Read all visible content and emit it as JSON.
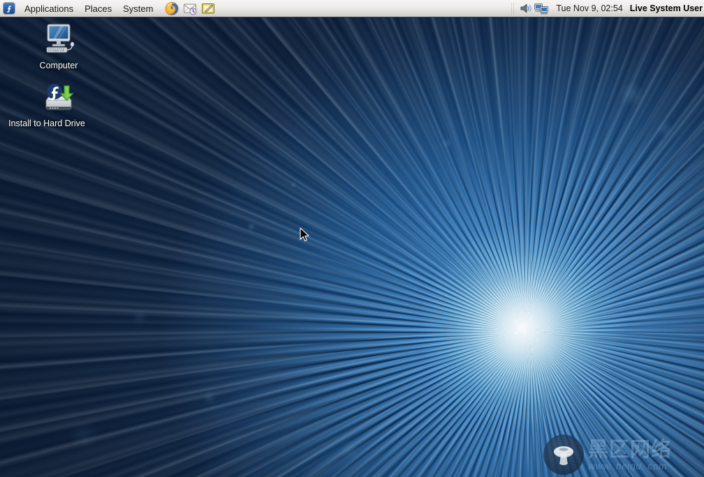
{
  "panel": {
    "distro_logo_name": "fedora-logo-icon",
    "menus": [
      {
        "label": "Applications",
        "name": "menu-applications"
      },
      {
        "label": "Places",
        "name": "menu-places"
      },
      {
        "label": "System",
        "name": "menu-system"
      }
    ],
    "launchers": [
      {
        "name": "firefox-launcher-icon",
        "title": "Firefox Web Browser"
      },
      {
        "name": "evolution-mail-launcher-icon",
        "title": "Evolution Mail"
      },
      {
        "name": "notes-editor-launcher-icon",
        "title": "Text Editor"
      }
    ],
    "tray": [
      {
        "name": "panel-drag-handle",
        "label": ""
      },
      {
        "name": "volume-icon",
        "label": ""
      },
      {
        "name": "display-monitors-icon",
        "label": ""
      }
    ],
    "clock": "Tue Nov  9, 02:54",
    "username": "Live System User"
  },
  "desktop": {
    "icons": [
      {
        "name": "desktop-icon-computer",
        "label": "Computer",
        "glyph": "computer-monitor-icon"
      },
      {
        "name": "desktop-icon-install-to-hard-drive",
        "label": "Install to Hard Drive",
        "glyph": "hard-drive-install-icon"
      }
    ],
    "wallpaper_name": "fedora-laughlin-burst-wallpaper",
    "cursor_name": "arrow-pointer-cursor"
  },
  "watermark": {
    "logo_name": "mushroom-logo-icon",
    "title_cn": "黑区网络",
    "url": "www. heiqu. com"
  },
  "colors": {
    "panel_bg": "#eeedeb",
    "panel_border": "#2b3d52",
    "wallpaper_deep": "#0b1c36",
    "wallpaper_mid": "#1e63ad",
    "wallpaper_core": "#f5fbff",
    "accent_blue": "#2c5ea8",
    "label_text": "#ffffff"
  }
}
